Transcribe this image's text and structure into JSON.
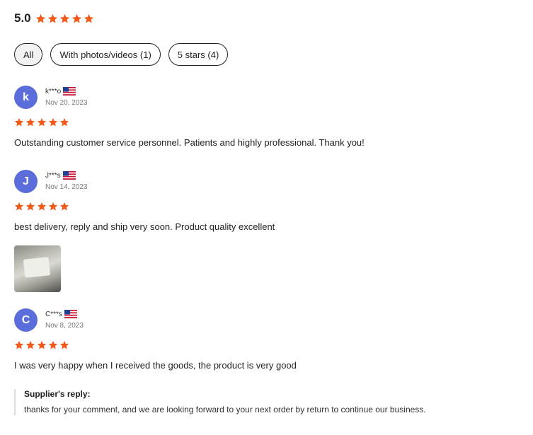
{
  "summary": {
    "score": "5.0",
    "stars": 5,
    "star_color": "#f05a1a"
  },
  "filters": [
    {
      "label": "All",
      "active": true
    },
    {
      "label": "With photos/videos (1)",
      "active": false
    },
    {
      "label": "5 stars (4)",
      "active": false
    }
  ],
  "reviews": [
    {
      "initial": "k",
      "user": "k***o",
      "country_flag": "us-flag",
      "date": "Nov 20, 2023",
      "rating": 5,
      "text": "Outstanding customer service personnel. Patients and highly professional. Thank you!"
    },
    {
      "initial": "J",
      "user": "J***s",
      "country_flag": "us-flag",
      "date": "Nov 14, 2023",
      "rating": 5,
      "text": "best delivery, reply and ship very soon. Product quality excellent",
      "has_photo": true
    },
    {
      "initial": "C",
      "user": "C***s",
      "country_flag": "us-flag",
      "date": "Nov 8, 2023",
      "rating": 5,
      "text": "I was very happy when I received the goods, the product is very good",
      "supplier_reply": {
        "title": "Supplier's reply:",
        "text": "thanks for your comment, and we are looking forward to your next order by return to continue our business."
      }
    }
  ],
  "colors": {
    "avatar": "#5b6ddb",
    "star": "#f05a1a"
  }
}
